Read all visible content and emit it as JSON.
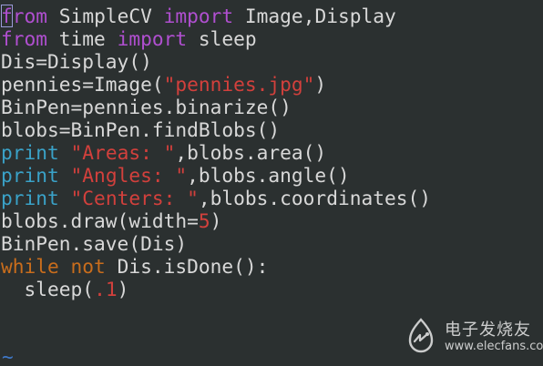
{
  "editor": {
    "lines": [
      [
        {
          "t": "from",
          "c": "kw-m"
        },
        {
          "t": " SimpleCV "
        },
        {
          "t": "import",
          "c": "kw-m"
        },
        {
          "t": " Image,Display"
        }
      ],
      [
        {
          "t": "from",
          "c": "kw-m"
        },
        {
          "t": " time "
        },
        {
          "t": "import",
          "c": "kw-m"
        },
        {
          "t": " sleep"
        }
      ],
      [
        {
          "t": "Dis=Display()"
        }
      ],
      [
        {
          "t": "pennies=Image("
        },
        {
          "t": "\"pennies.jpg\"",
          "c": "str"
        },
        {
          "t": ")"
        }
      ],
      [
        {
          "t": "BinPen=pennies.binarize()"
        }
      ],
      [
        {
          "t": "blobs=BinPen.findBlobs()"
        }
      ],
      [
        {
          "t": "print",
          "c": "kw-c"
        },
        {
          "t": " "
        },
        {
          "t": "\"Areas: \"",
          "c": "str"
        },
        {
          "t": ",blobs.area()"
        }
      ],
      [
        {
          "t": "print",
          "c": "kw-c"
        },
        {
          "t": " "
        },
        {
          "t": "\"Angles: \"",
          "c": "str"
        },
        {
          "t": ",blobs.angle()"
        }
      ],
      [
        {
          "t": "print",
          "c": "kw-c"
        },
        {
          "t": " "
        },
        {
          "t": "\"Centers: \"",
          "c": "str"
        },
        {
          "t": ",blobs.coordinates()"
        }
      ],
      [
        {
          "t": "blobs.draw(width="
        },
        {
          "t": "5",
          "c": "num"
        },
        {
          "t": ")"
        }
      ],
      [
        {
          "t": "BinPen.save(Dis)"
        }
      ],
      [
        {
          "t": "while",
          "c": "kw-o"
        },
        {
          "t": " "
        },
        {
          "t": "not",
          "c": "kw-o"
        },
        {
          "t": " Dis.isDone():"
        }
      ],
      [
        {
          "t": "  sleep("
        },
        {
          "t": ".1",
          "c": "num"
        },
        {
          "t": ")"
        }
      ]
    ],
    "empty_line_marker": "~"
  },
  "colors": {
    "background": "#2b3030",
    "text": "#d8d8d8",
    "keyword_magenta": "#b04fd0",
    "keyword_cyan": "#3aa2c8",
    "keyword_orange": "#c96d1c",
    "string_red": "#d2403c",
    "tilde_blue": "#3f78c8"
  },
  "watermark": {
    "name": "电子发烧友",
    "url": "www.elecfans.com",
    "icon": "elecfans-logo-icon"
  }
}
